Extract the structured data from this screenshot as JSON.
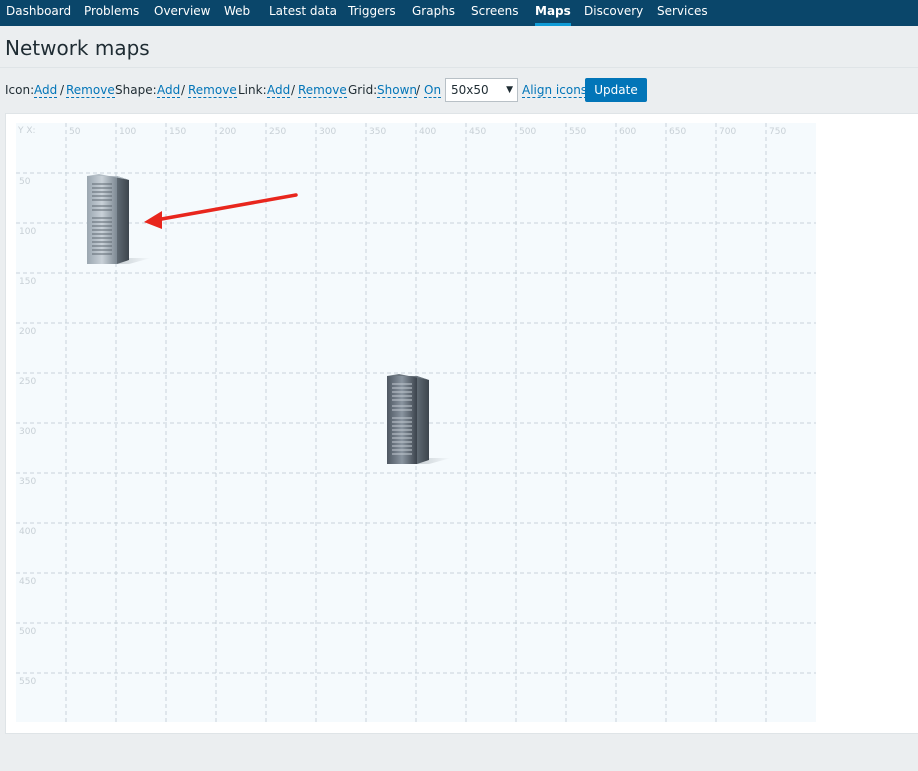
{
  "nav": {
    "items": [
      {
        "label": "Dashboard"
      },
      {
        "label": "Problems"
      },
      {
        "label": "Overview"
      },
      {
        "label": "Web"
      },
      {
        "label": "Latest data"
      },
      {
        "label": "Triggers"
      },
      {
        "label": "Graphs"
      },
      {
        "label": "Screens"
      },
      {
        "label": "Maps",
        "active": true
      },
      {
        "label": "Discovery"
      },
      {
        "label": "Services"
      }
    ]
  },
  "page": {
    "title": "Network maps"
  },
  "toolbar": {
    "icon_label": "Icon:",
    "icon_add": "Add",
    "icon_sep": "/",
    "icon_remove": "Remove",
    "shape_label": "Shape:",
    "shape_add": "Add",
    "shape_sep": "/",
    "shape_remove": "Remove",
    "link_label": "Link:",
    "link_add": "Add",
    "link_sep": "/",
    "link_remove": "Remove",
    "grid_label": "Grid:",
    "grid_shown": "Shown",
    "grid_sep": "/",
    "grid_on": "On",
    "grid_size": "50x50",
    "align_icons": "Align icons",
    "update": "Update"
  },
  "map": {
    "corner_label": "Y X:",
    "x_ticks": [
      "50",
      "100",
      "150",
      "200",
      "250",
      "300",
      "350",
      "400",
      "450",
      "500",
      "550",
      "600",
      "650",
      "700",
      "750"
    ],
    "y_ticks": [
      "50",
      "100",
      "150",
      "200",
      "250",
      "300",
      "350",
      "400",
      "450",
      "500",
      "550"
    ],
    "icon_name": "server-icon",
    "annotation_color": "#e8261d",
    "grid_color": "#c9d3da",
    "bg_color": "#f5fafd"
  }
}
